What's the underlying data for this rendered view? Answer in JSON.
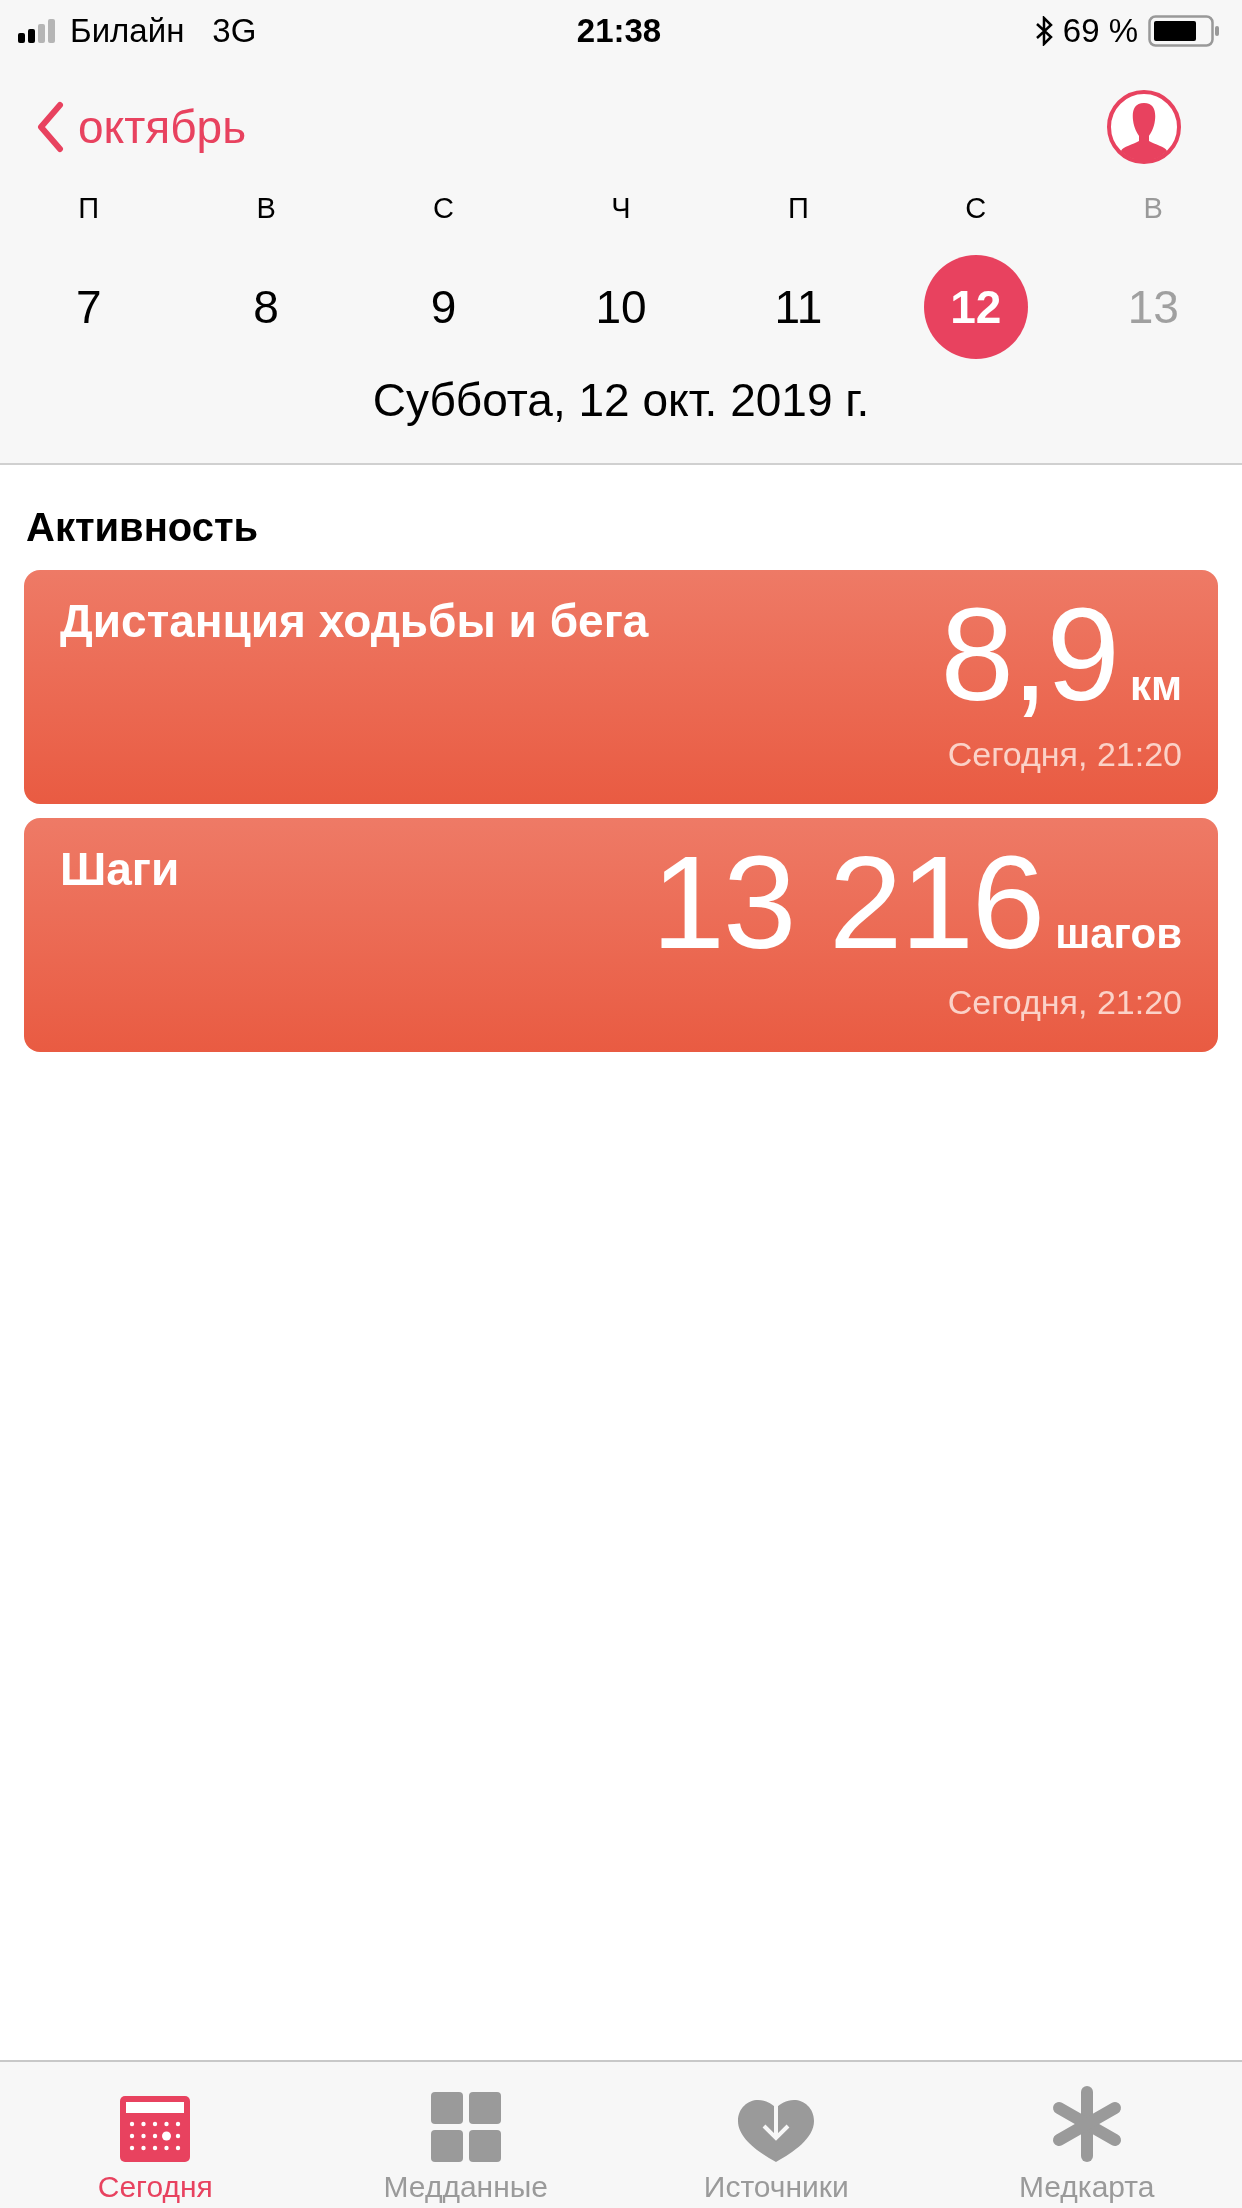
{
  "status_bar": {
    "carrier": "Билайн",
    "network": "3G",
    "time": "21:38",
    "battery": "69 %"
  },
  "nav": {
    "back": "октябрь"
  },
  "week": [
    {
      "weekday": "П",
      "day": "7",
      "selected": false,
      "future": false
    },
    {
      "weekday": "В",
      "day": "8",
      "selected": false,
      "future": false
    },
    {
      "weekday": "С",
      "day": "9",
      "selected": false,
      "future": false
    },
    {
      "weekday": "Ч",
      "day": "10",
      "selected": false,
      "future": false
    },
    {
      "weekday": "П",
      "day": "11",
      "selected": false,
      "future": false
    },
    {
      "weekday": "С",
      "day": "12",
      "selected": true,
      "future": false
    },
    {
      "weekday": "В",
      "day": "13",
      "selected": false,
      "future": true
    }
  ],
  "date": "Суббота, 12 окт. 2019 г.",
  "section": "Активность",
  "cards": [
    {
      "title": "Дистанция ходьбы и бега",
      "value": "8,9",
      "unit": "км",
      "time": "Сегодня, 21:20"
    },
    {
      "title": "Шаги",
      "value": "13 216",
      "unit": "шагов",
      "time": "Сегодня, 21:20"
    }
  ],
  "tabs": [
    {
      "label": "Сегодня",
      "kind": "today",
      "selected": true
    },
    {
      "label": "Медданные",
      "kind": "data",
      "selected": false
    },
    {
      "label": "Источники",
      "kind": "sources",
      "selected": false
    },
    {
      "label": "Медкарта",
      "kind": "medical",
      "selected": false
    }
  ]
}
